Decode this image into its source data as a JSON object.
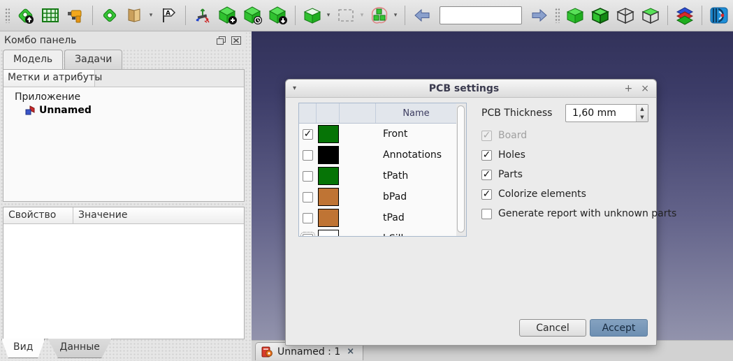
{
  "toolbar": {
    "search_value": "",
    "icons": [
      "pcb-export",
      "parts-list",
      "drill",
      "pad",
      "library-folder",
      "annotation-flag",
      "assembly-axes",
      "add-model",
      "model-history",
      "download-model",
      "solid-cube",
      "selection-box",
      "explode-groups",
      "nav-back",
      "nav-forward",
      "display-solid",
      "display-shaded",
      "display-wireframe",
      "display-hybrid",
      "layers",
      "kicad"
    ]
  },
  "panel": {
    "title": "Комбо панель",
    "tabs": [
      {
        "label": "Модель"
      },
      {
        "label": "Задачи"
      }
    ],
    "tree_header": "Метки и атрибуты",
    "tree": {
      "root": "Приложение",
      "child": "Unnamed"
    },
    "properties": {
      "col_property": "Свойство",
      "col_value": "Значение"
    },
    "bottom_tabs": [
      {
        "label": "Вид"
      },
      {
        "label": "Данные"
      }
    ]
  },
  "viewport": {
    "top_color": "#32325a",
    "bottom_color": "#9293ac"
  },
  "mdi": {
    "tab_label": "Unnamed : 1",
    "close_glyph": "×"
  },
  "dialog": {
    "title": "PCB settings",
    "titlebar": {
      "menu_glyph": "▾",
      "shade_glyph": "+",
      "close_glyph": "×"
    },
    "layers": {
      "name_header": "Name",
      "rows": [
        {
          "name": "Front",
          "checked": true,
          "color": "#067406"
        },
        {
          "name": "Annotations",
          "checked": false,
          "color": "#000000"
        },
        {
          "name": "tPath",
          "checked": false,
          "color": "#067406"
        },
        {
          "name": "bPad",
          "checked": false,
          "color": "#bf7434"
        },
        {
          "name": "tPad",
          "checked": false,
          "color": "#bf7434"
        },
        {
          "name": "bSilk",
          "checked": false,
          "color": "#ffffff",
          "focused": true
        }
      ]
    },
    "thickness": {
      "label": "PCB Thickness",
      "value": "1,60 mm"
    },
    "options": [
      {
        "label": "Board",
        "checked": true,
        "disabled": true
      },
      {
        "label": "Holes",
        "checked": true
      },
      {
        "label": "Parts",
        "checked": true
      },
      {
        "label": "Colorize elements",
        "checked": true
      },
      {
        "label": "Generate report with unknown parts",
        "checked": false
      }
    ],
    "cancel_label": "Cancel",
    "accept_label": "Accept",
    "accent_color": "#6d8fb2"
  }
}
